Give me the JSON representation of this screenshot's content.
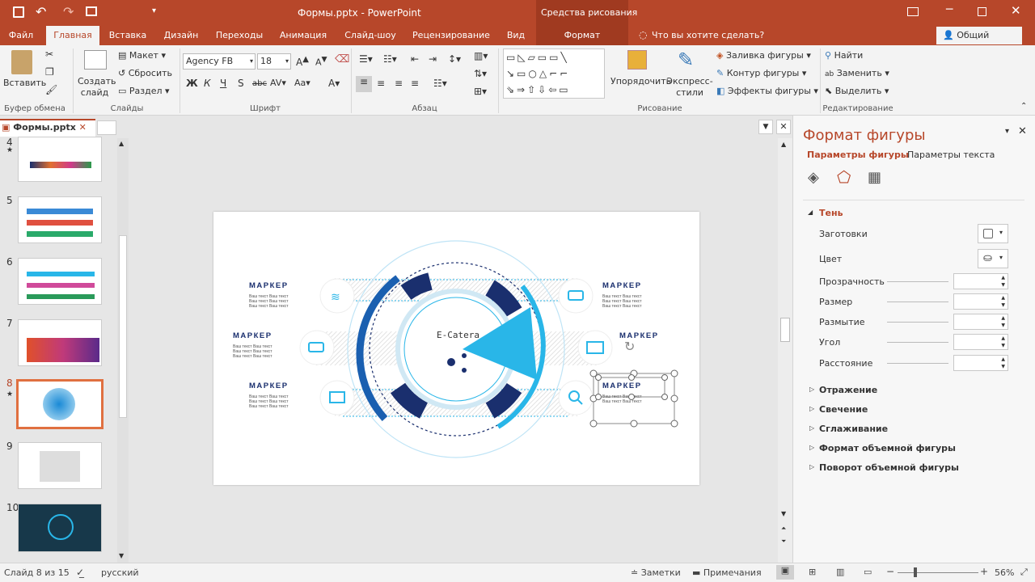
{
  "titlebar": {
    "doc_title": "Формы.pptx - PowerPoint",
    "context_title": "Средства рисования"
  },
  "tabs": [
    "Файл",
    "Главная",
    "Вставка",
    "Дизайн",
    "Переходы",
    "Анимация",
    "Слайд-шоу",
    "Рецензирование",
    "Вид",
    "Формат"
  ],
  "tellme": "Что вы хотите сделать?",
  "share": "Общий доступ",
  "ribbon": {
    "paste": "Вставить",
    "clipboard": "Буфер обмена",
    "new_slide": "Создать слайд",
    "layout": "Макет",
    "reset": "Сбросить",
    "section": "Раздел",
    "slides": "Слайды",
    "font_name": "Agency FB",
    "font_size": "18",
    "font_group": "Шрифт",
    "paragraph_group": "Абзац",
    "arrange": "Упорядочить",
    "quick_styles": "Экспресс-стили",
    "fill": "Заливка фигуры",
    "outline": "Контур фигуры",
    "effects": "Эффекты фигуры",
    "drawing_group": "Рисование",
    "find": "Найти",
    "replace": "Заменить",
    "select": "Выделить",
    "editing_group": "Редактирование"
  },
  "doc_tab": "Формы.pptx",
  "thumbnails": [
    "4",
    "5",
    "6",
    "7",
    "8",
    "9",
    "10"
  ],
  "slide": {
    "center_text": "E-Catera",
    "markers": [
      "МАРКЕР",
      "МАРКЕР",
      "МАРКЕР",
      "МАРКЕР",
      "МАРКЕР",
      "МАРКЕР"
    ],
    "body_line": "Ваш текст Ваш текст"
  },
  "pane": {
    "title": "Формат фигуры",
    "tab_shape": "Параметры фигуры",
    "tab_text": "Параметры текста",
    "shadow": "Тень",
    "presets": "Заготовки",
    "color": "Цвет",
    "transparency": "Прозрачность",
    "size": "Размер",
    "blur": "Размытие",
    "angle": "Угол",
    "distance": "Расстояние",
    "reflection": "Отражение",
    "glow": "Свечение",
    "soft_edges": "Сглаживание",
    "format_3d": "Формат объемной фигуры",
    "rotation_3d": "Поворот объемной фигуры"
  },
  "status": {
    "slide": "Слайд 8 из 15",
    "language": "русский",
    "notes": "Заметки",
    "comments": "Примечания",
    "zoom": "56%"
  },
  "colors": {
    "accent": "#b7472a",
    "slide_cyan": "#29b6e8",
    "slide_navy": "#1a2f6e"
  }
}
